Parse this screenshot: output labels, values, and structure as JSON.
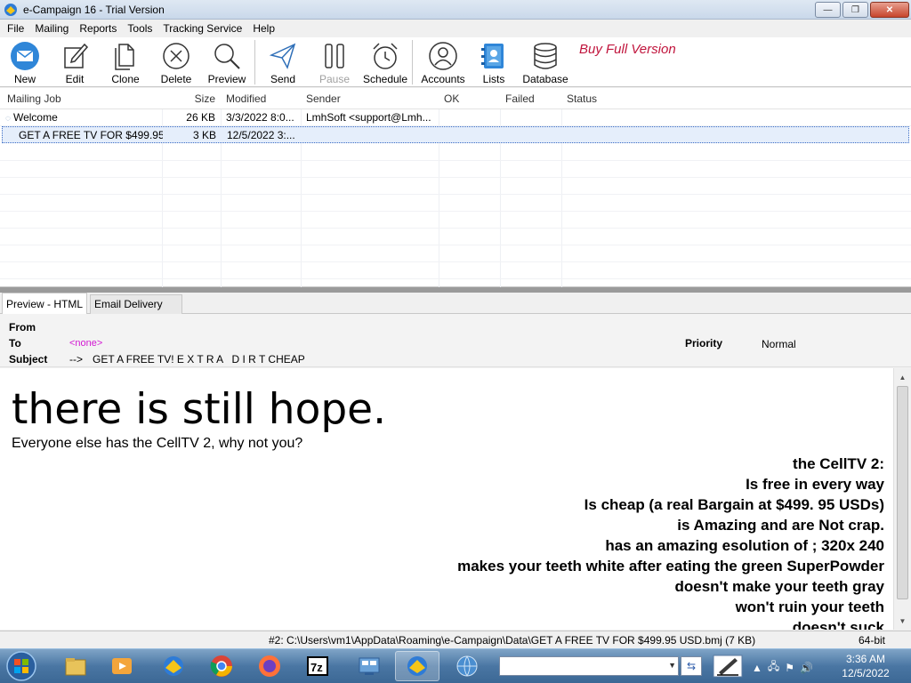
{
  "window": {
    "title": "e-Campaign 16 - Trial Version",
    "controls": {
      "minimize": "—",
      "maximize": "❐",
      "close": "✕"
    }
  },
  "menu": [
    "File",
    "Mailing",
    "Reports",
    "Tools",
    "Tracking Service",
    "Help"
  ],
  "toolbar": {
    "buttons": [
      {
        "label": "New",
        "icon": "new-mail-icon",
        "enabled": true
      },
      {
        "label": "Edit",
        "icon": "edit-icon",
        "enabled": true
      },
      {
        "label": "Clone",
        "icon": "clone-icon",
        "enabled": true
      },
      {
        "label": "Delete",
        "icon": "delete-icon",
        "enabled": true
      },
      {
        "label": "Preview",
        "icon": "preview-icon",
        "enabled": true
      },
      {
        "label": "Send",
        "icon": "send-icon",
        "enabled": true
      },
      {
        "label": "Pause",
        "icon": "pause-icon",
        "enabled": false
      },
      {
        "label": "Schedule",
        "icon": "schedule-icon",
        "enabled": true
      },
      {
        "label": "Accounts",
        "icon": "accounts-icon",
        "enabled": true
      },
      {
        "label": "Lists",
        "icon": "lists-icon",
        "enabled": true
      },
      {
        "label": "Database",
        "icon": "database-icon",
        "enabled": true
      }
    ],
    "buy_link": "Buy Full Version",
    "buy_color": "#c0143c"
  },
  "joblist": {
    "columns": [
      "Mailing Job",
      "Size",
      "Modified",
      "Sender",
      "OK",
      "Failed",
      "Status"
    ],
    "rows": [
      {
        "name": "Welcome",
        "size": "26 KB",
        "modified": "3/3/2022 8:0...",
        "sender": "LmhSoft <support@Lmh...",
        "ok": "",
        "failed": "",
        "status": "",
        "selected": false
      },
      {
        "name": "GET A FREE TV FOR $499.95 ...",
        "size": "3 KB",
        "modified": "12/5/2022 3:...",
        "sender": "",
        "ok": "",
        "failed": "",
        "status": "",
        "selected": true
      }
    ]
  },
  "tabs": [
    {
      "label": "Preview - HTML",
      "active": true
    },
    {
      "label": "Email Delivery Log",
      "active": false
    }
  ],
  "mail_header": {
    "from_label": "From",
    "to_label": "To",
    "to_value": "<none>",
    "subject_label": "Subject",
    "subject_arrow": "-->",
    "subject_value": "GET A FREE TV! E X T R A   D I R T CHEAP",
    "priority_label": "Priority",
    "priority_value": "Normal"
  },
  "preview": {
    "headline": "there is still hope.",
    "subline": "Everyone else has the CellTV 2, why not you?",
    "lines": [
      "the CellTV 2:",
      "Is free in every way",
      "Is cheap (a real Bargain at $499. 95 USDs)",
      "is Amazing and are Not crap.",
      "has an amazing esolution of ; 320x 240",
      "makes your teeth white after eating the green SuperPowder",
      "doesn't make your teeth gray",
      "won't ruin your teeth",
      "doesn't suck"
    ]
  },
  "statusbar": {
    "path": "#2: C:\\Users\\vm1\\AppData\\Roaming\\e-Campaign\\Data\\GET A FREE TV FOR $499.95 USD.bmj (7 KB)",
    "arch": "64-bit"
  },
  "taskbar": {
    "apps": [
      "explorer-icon",
      "media-player-icon",
      "e-campaign-icon",
      "chrome-icon",
      "firefox-icon",
      "7zip-icon",
      "control-panel-icon",
      "e-campaign-active-icon",
      "network-globe-icon"
    ],
    "address_value": "",
    "clock_time": "3:36 AM",
    "clock_date": "12/5/2022"
  }
}
